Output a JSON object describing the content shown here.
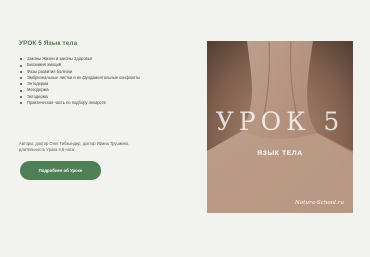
{
  "lesson": {
    "title": "УРОК 5 Язык тела",
    "topics": [
      "Законы Жизни и законы Здоровья",
      "Биохимия эмоций",
      "Фазы развития болезни",
      "Эмбриональные листки и их фундаментальные конфликты",
      "Энтодерма",
      "Мезодерма",
      "Эктодерма",
      "Практическая часть по подбору лекарств"
    ],
    "authors": "Авторы: доктор Олег Гибзындер, доктор Ирина Трушкина",
    "duration": "длительность Урока 4,5 часа",
    "button_label": "Подробнее об Уроке"
  },
  "promo": {
    "heading": "УРОК 5",
    "subtitle": "ЯЗЫК ТЕЛА",
    "site": "Natura-School.ru"
  },
  "colors": {
    "accent": "#4f7f55",
    "title": "#4a7a52",
    "background": "#f2f2ef"
  }
}
